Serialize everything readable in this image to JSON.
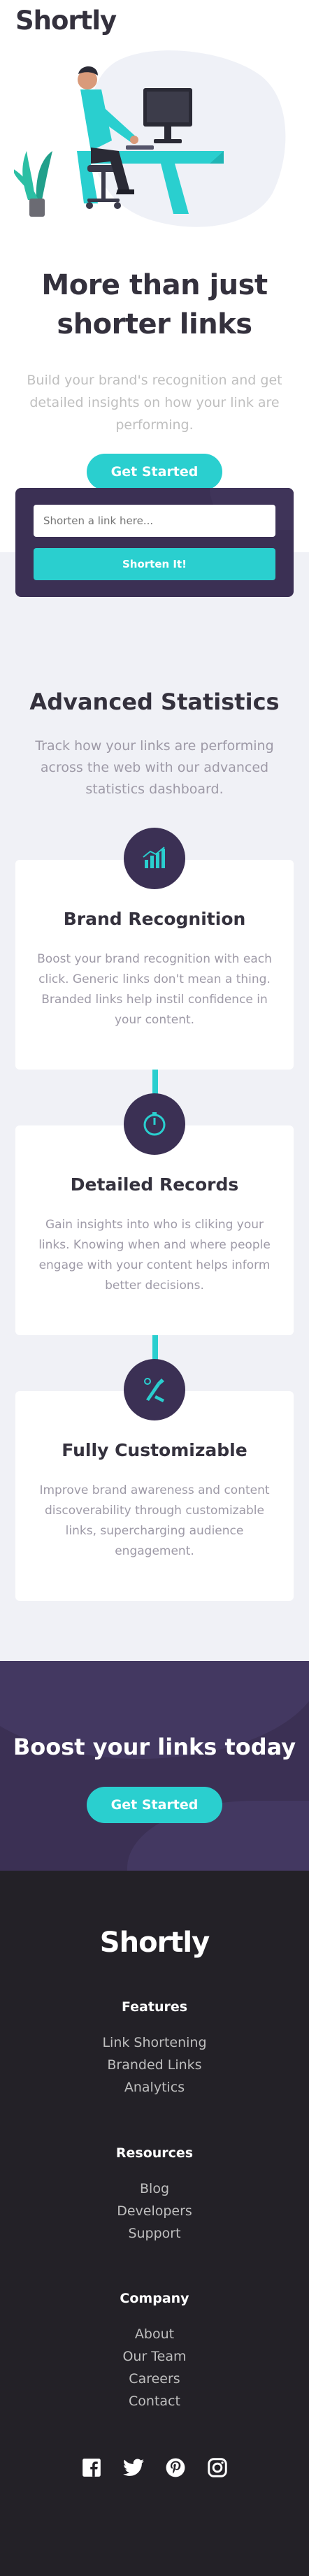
{
  "header": {
    "logo": "Shortly"
  },
  "hero": {
    "title_line1": "More than just",
    "title_line2": "shorter links",
    "subtitle": "Build your brand's recognition and get detailed insights on how your link are performing.",
    "cta": "Get Started"
  },
  "shorten": {
    "placeholder": "Shorten a link here...",
    "button": "Shorten It!"
  },
  "stats": {
    "title": "Advanced Statistics",
    "subtitle": "Track how your links are performing across the web with our advanced statistics dashboard.",
    "cards": [
      {
        "title": "Brand Recognition",
        "text": "Boost your brand recognition with each click. Generic links don't mean a thing. Branded links help instil confidence in your content.",
        "icon": "brand-recognition-icon"
      },
      {
        "title": "Detailed Records",
        "text": "Gain insights into who is cliking your links. Knowing when and where people engage with your content helps inform better decisions.",
        "icon": "detailed-records-icon"
      },
      {
        "title": "Fully Customizable",
        "text": "Improve brand awareness and content discoverability through customizable links, supercharging audience engagement.",
        "icon": "fully-customizable-icon"
      }
    ]
  },
  "boost": {
    "title": "Boost your links today",
    "cta": "Get Started"
  },
  "footer": {
    "logo": "Shortly",
    "sections": [
      {
        "heading": "Features",
        "links": [
          "Link Shortening",
          "Branded Links",
          "Analytics"
        ]
      },
      {
        "heading": "Resources",
        "links": [
          "Blog",
          "Developers",
          "Support"
        ]
      },
      {
        "heading": "Company",
        "links": [
          "About",
          "Our Team",
          "Careers",
          "Contact"
        ]
      }
    ],
    "socials": [
      "facebook-icon",
      "twitter-icon",
      "pinterest-icon",
      "instagram-icon"
    ]
  },
  "colors": {
    "cyan": "#2acfcf",
    "dark_violet": "#3b3054",
    "very_dark": "#232127",
    "gray": "#9e9aa7",
    "light_bg": "#f0f1f6"
  }
}
